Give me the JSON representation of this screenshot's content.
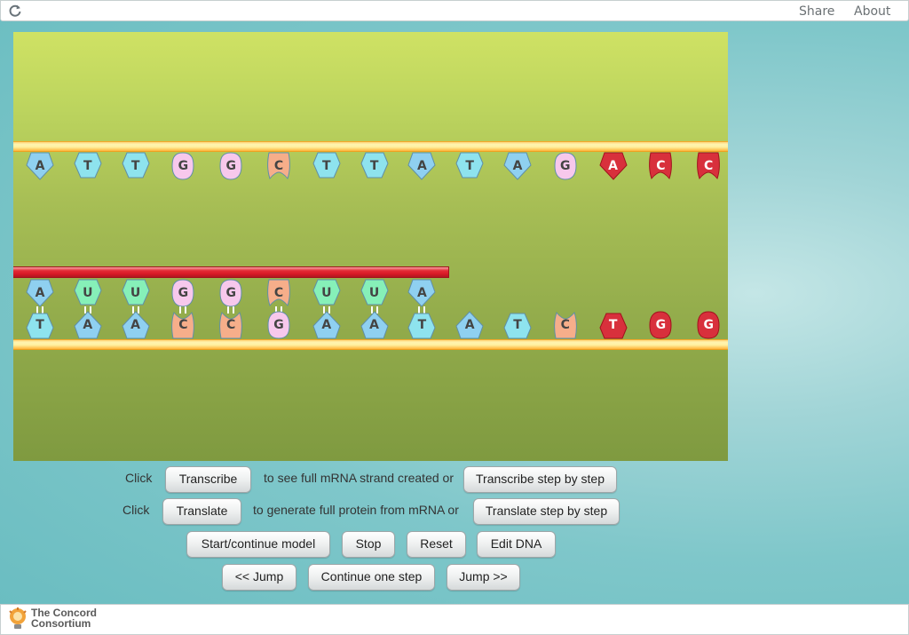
{
  "topbar": {
    "reload_icon": "reload-icon",
    "share_label": "Share",
    "about_label": "About"
  },
  "colors": {
    "A": "#8fd0f0",
    "T": "#8ee3ee",
    "U": "#86f0b8",
    "G": "#f7c8ec",
    "C": "#f6ae8a",
    "highlight": "#d8303c"
  },
  "dna_top_strand": [
    {
      "base": "A",
      "style": "normal"
    },
    {
      "base": "T",
      "style": "normal"
    },
    {
      "base": "T",
      "style": "normal"
    },
    {
      "base": "G",
      "style": "normal"
    },
    {
      "base": "G",
      "style": "normal"
    },
    {
      "base": "C",
      "style": "normal"
    },
    {
      "base": "T",
      "style": "normal"
    },
    {
      "base": "T",
      "style": "normal"
    },
    {
      "base": "A",
      "style": "normal"
    },
    {
      "base": "T",
      "style": "normal"
    },
    {
      "base": "A",
      "style": "normal"
    },
    {
      "base": "G",
      "style": "normal"
    },
    {
      "base": "A",
      "style": "highlight"
    },
    {
      "base": "C",
      "style": "highlight"
    },
    {
      "base": "C",
      "style": "highlight"
    }
  ],
  "mrna_strand": [
    {
      "base": "A"
    },
    {
      "base": "U"
    },
    {
      "base": "U"
    },
    {
      "base": "G"
    },
    {
      "base": "G"
    },
    {
      "base": "C"
    },
    {
      "base": "U"
    },
    {
      "base": "U"
    },
    {
      "base": "A"
    }
  ],
  "dna_template_strand": [
    {
      "base": "T",
      "style": "normal"
    },
    {
      "base": "A",
      "style": "normal"
    },
    {
      "base": "A",
      "style": "normal"
    },
    {
      "base": "C",
      "style": "normal"
    },
    {
      "base": "C",
      "style": "normal"
    },
    {
      "base": "G",
      "style": "normal"
    },
    {
      "base": "A",
      "style": "normal"
    },
    {
      "base": "A",
      "style": "normal"
    },
    {
      "base": "T",
      "style": "normal"
    },
    {
      "base": "A",
      "style": "normal"
    },
    {
      "base": "T",
      "style": "normal"
    },
    {
      "base": "C",
      "style": "normal"
    },
    {
      "base": "T",
      "style": "highlight"
    },
    {
      "base": "G",
      "style": "highlight"
    },
    {
      "base": "G",
      "style": "highlight"
    }
  ],
  "controls": {
    "row1": {
      "click_label": "Click",
      "transcribe": "Transcribe",
      "middle_text": "to see full mRNA strand created or",
      "step": "Transcribe step by step"
    },
    "row2": {
      "click_label": "Click",
      "translate": "Translate",
      "middle_text": "to generate full protein from mRNA or",
      "step": "Translate step by step"
    },
    "row3": {
      "start": "Start/continue model",
      "stop": "Stop",
      "reset": "Reset",
      "edit": "Edit DNA"
    },
    "row4": {
      "jump_back": "<< Jump",
      "continue": "Continue one step",
      "jump_fwd": "Jump >>"
    }
  },
  "footer": {
    "logo_icon": "concord-lightbulb-icon",
    "logo_line1": "The Concord",
    "logo_line2": "Consortium"
  }
}
